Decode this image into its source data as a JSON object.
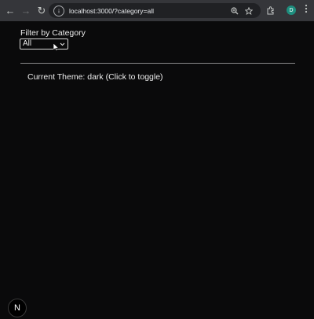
{
  "browser": {
    "back_glyph": "←",
    "forward_glyph": "→",
    "reload_glyph": "↻",
    "url": "localhost:3000/?category=all",
    "avatar_initial": "D",
    "icons": [
      "back-icon",
      "forward-icon",
      "reload-icon",
      "site-info-icon",
      "zoom-icon",
      "bookmark-star-icon",
      "extensions-icon",
      "profile-avatar",
      "menu-icon"
    ]
  },
  "filter": {
    "label": "Filter by Category",
    "selected": "All"
  },
  "theme": {
    "toggle_text": "Current Theme: dark (Click to toggle)"
  },
  "next_badge": {
    "letter": "N"
  },
  "colors": {
    "background": "#0a0a0b",
    "chrome": "#35363a",
    "omnibox": "#202124",
    "text": "#ededed",
    "avatar": "#1e8e7e"
  }
}
